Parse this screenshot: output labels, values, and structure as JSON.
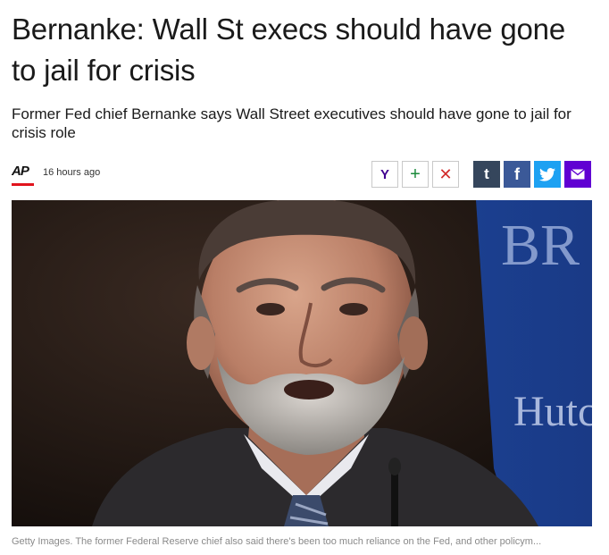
{
  "article": {
    "headline": "Bernanke: Wall St execs should have gone to jail for crisis",
    "summary": "Former Fed chief Bernanke says Wall Street executives should have gone to jail for crisis role",
    "source_logo": "AP",
    "timestamp": "16 hours ago"
  },
  "share": {
    "yahoo_label": "Y",
    "add_label": "+",
    "close_label": "✕",
    "tumblr_label": "t",
    "facebook_label": "f",
    "twitter_icon": "twitter-bird-icon",
    "mail_icon": "mail-icon"
  },
  "photo": {
    "backdrop_text_top": "BR",
    "backdrop_text_bottom": "Hutc",
    "caption": "Getty Images. The former Federal Reserve chief also said there's been too much reliance on the Fed, and other policym..."
  },
  "colors": {
    "ap_red": "#e1141d",
    "yahoo_purple": "#400090",
    "tumblr": "#35465c",
    "facebook": "#3b5998",
    "twitter": "#1da1f2",
    "mail": "#6001d2"
  }
}
